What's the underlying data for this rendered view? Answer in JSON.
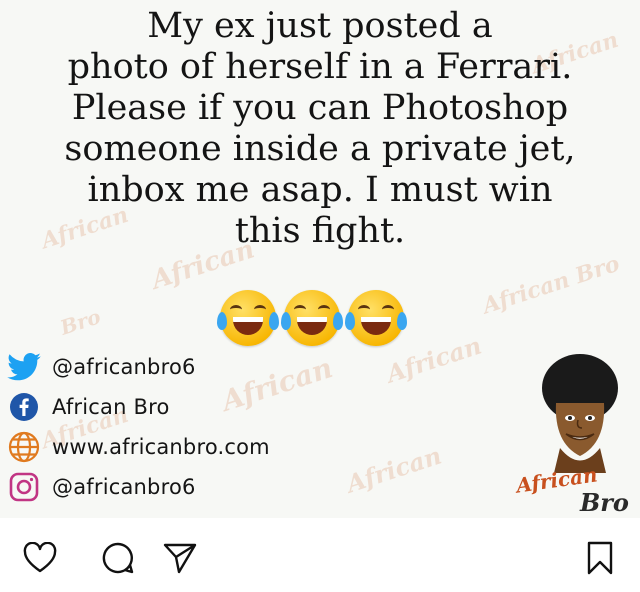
{
  "post": {
    "caption_lines": [
      "My ex just posted a",
      "photo of herself in a Ferrari.",
      "Please if you can Photoshop",
      "someone inside a private jet,",
      "inbox me asap. I must win",
      "this fight."
    ],
    "emoji_icons": [
      "face-with-tears-of-joy-icon",
      "face-with-tears-of-joy-icon",
      "face-with-tears-of-joy-icon"
    ],
    "watermark": "African",
    "watermark_alt": "African Bro",
    "watermark_bro": "Bro",
    "social": [
      {
        "icon": "twitter-icon",
        "text": "@africanbro6",
        "color": "#1da1f2"
      },
      {
        "icon": "facebook-icon",
        "text": "African Bro",
        "color": "#1877f2"
      },
      {
        "icon": "globe-icon",
        "text": "www.africanbro.com",
        "color": "#e07a1f"
      },
      {
        "icon": "instagram-icon",
        "text": "@africanbro6",
        "color": "#c13584"
      }
    ],
    "mascot_label_1": "African",
    "mascot_label_2": "Bro"
  },
  "actions": {
    "icons": [
      "heart-icon",
      "comment-icon",
      "share-icon",
      "bookmark-icon"
    ]
  }
}
